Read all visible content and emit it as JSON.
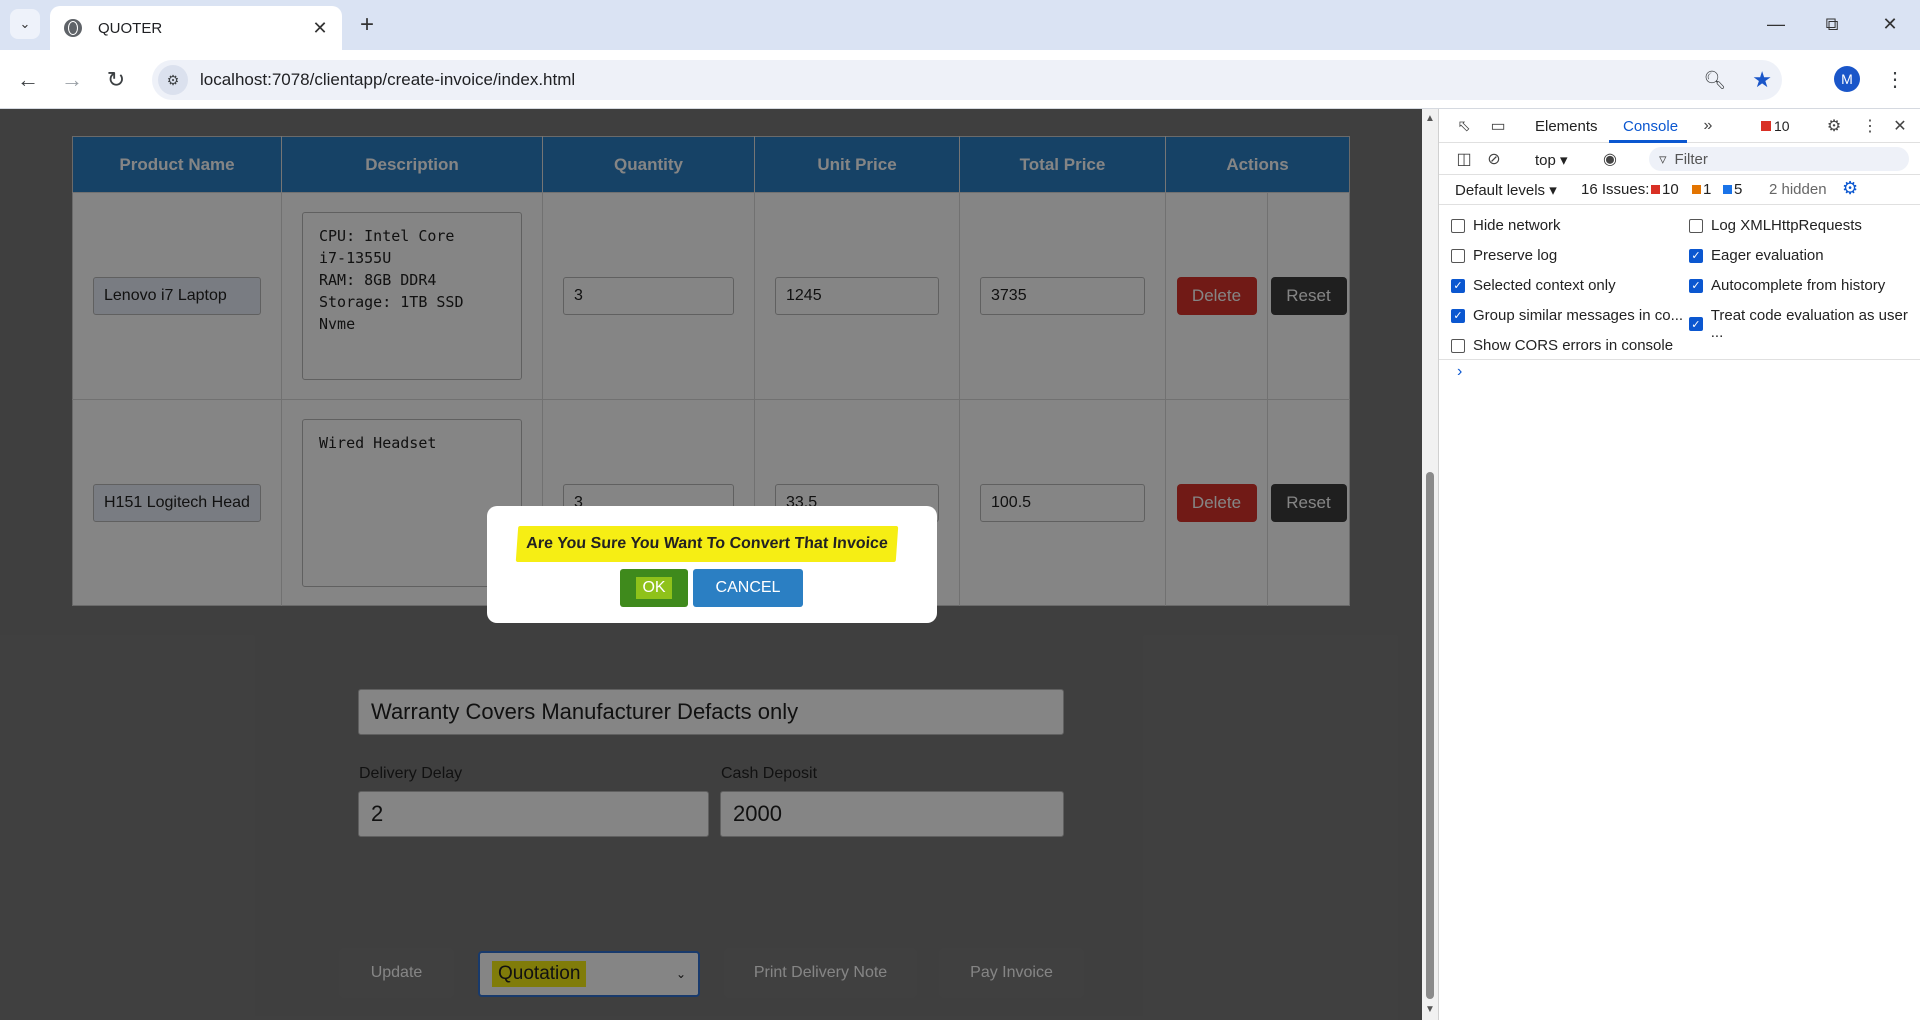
{
  "browser": {
    "tab_title": "QUOTER",
    "url": "localhost:7078/clientapp/create-invoice/index.html",
    "avatar_letter": "M"
  },
  "table": {
    "headers": [
      "Product Name",
      "Description",
      "Quantity",
      "Unit Price",
      "Total Price",
      "Actions"
    ],
    "rows": [
      {
        "product": "Lenovo i7 Laptop",
        "description": "CPU: Intel Core\ni7-1355U\nRAM: 8GB DDR4\nStorage: 1TB SSD\nNvme",
        "quantity": "3",
        "unit_price": "1245",
        "total_price": "3735",
        "delete_label": "Delete",
        "reset_label": "Reset"
      },
      {
        "product": "H151 Logitech Head",
        "description": "Wired Headset",
        "quantity": "3",
        "unit_price": "33.5",
        "total_price": "100.5",
        "delete_label": "Delete",
        "reset_label": "Reset"
      }
    ]
  },
  "form": {
    "warranty": "Warranty Covers Manufacturer Defacts only",
    "delivery_delay_label": "Delivery Delay",
    "delivery_delay": "2",
    "cash_deposit_label": "Cash Deposit",
    "cash_deposit": "2000"
  },
  "actions": {
    "update": "Update",
    "status": "Quotation",
    "print_delivery": "Print Delivery Note",
    "pay_invoice": "Pay Invoice"
  },
  "dialog": {
    "message": "Are You Sure You Want To Convert That Invoice",
    "ok": "OK",
    "cancel": "CANCEL"
  },
  "devtools": {
    "tab_elements": "Elements",
    "tab_console": "Console",
    "error_count": "10",
    "context": "top",
    "filter_placeholder": "Filter",
    "levels": "Default levels",
    "issues_label": "16 Issues:",
    "issues_errors": "10",
    "issues_warnings": "1",
    "issues_info": "5",
    "hidden": "2 hidden",
    "settings_left": [
      {
        "label": "Hide network",
        "checked": false
      },
      {
        "label": "Preserve log",
        "checked": false
      },
      {
        "label": "Selected context only",
        "checked": true
      },
      {
        "label": "Group similar messages in co...",
        "checked": true
      },
      {
        "label": "Show CORS errors in console",
        "checked": false
      }
    ],
    "settings_right": [
      {
        "label": "Log XMLHttpRequests",
        "checked": false
      },
      {
        "label": "Eager evaluation",
        "checked": true
      },
      {
        "label": "Autocomplete from history",
        "checked": true
      },
      {
        "label": "Treat code evaluation as user ...",
        "checked": true
      }
    ],
    "accent_color": "#0b57d0"
  },
  "colors": {
    "table_header": "#2b7fc3",
    "delete": "#d9332b",
    "ok": "#3f8a1c",
    "cancel": "#2b7fc3",
    "highlight": "#f6ee14"
  }
}
